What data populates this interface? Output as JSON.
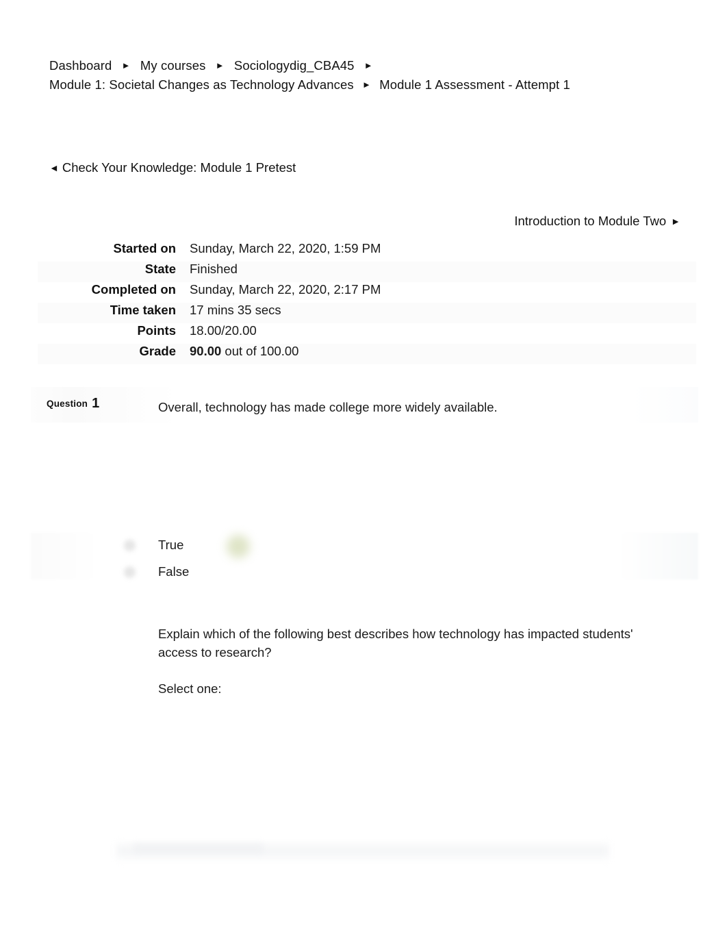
{
  "breadcrumb": {
    "separator": "►",
    "line1": [
      {
        "label": "Dashboard"
      },
      {
        "label": "My  courses"
      },
      {
        "label": "Sociologydig_CBA45"
      }
    ],
    "line2": [
      {
        "label": "Module 1: Societal Changes as Technology Advances"
      },
      {
        "label": "Module 1 Assessment - Attempt 1"
      }
    ]
  },
  "nav": {
    "prev_arrow": "◄",
    "prev_label": "Check Your Knowledge: Module 1 Pretest",
    "next_label": "Introduction to Module Two",
    "next_arrow": "►"
  },
  "summary": {
    "rows": [
      {
        "label": "Started on",
        "value": "Sunday, March 22, 2020, 1:59 PM"
      },
      {
        "label": "State",
        "value": "Finished"
      },
      {
        "label": "Completed on",
        "value": "Sunday, March 22, 2020, 2:17 PM"
      },
      {
        "label": "Time taken",
        "value": "17 mins 35 secs"
      },
      {
        "label": "Points",
        "value": "18.00/20.00"
      }
    ],
    "grade": {
      "label": "Grade",
      "score": "90.00",
      "suffix": " out of 100.00"
    }
  },
  "question1": {
    "number_word": "Question",
    "number": "1",
    "text": "Overall, technology has made college more widely available.",
    "options": [
      {
        "label": "True"
      },
      {
        "label": "False"
      }
    ]
  },
  "question2": {
    "text": "Explain which of the following best describes how technology has impacted students' access to research?",
    "select_prompt": "Select one:"
  },
  "colors": {
    "text": "#1a1a1a",
    "background": "#ffffff",
    "row_alt": "#fbfbfb",
    "correct_marker": "#dde3c4",
    "radio": "#e2e2e2"
  }
}
